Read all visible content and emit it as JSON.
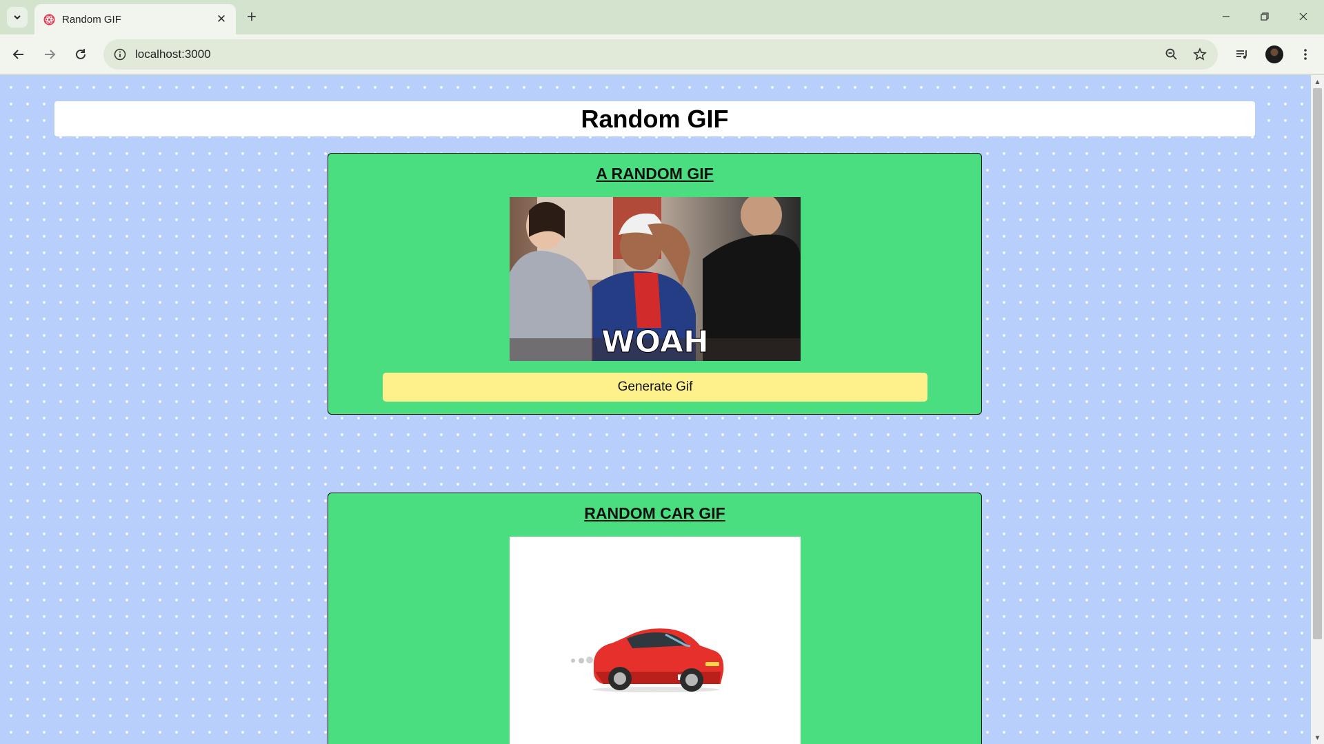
{
  "browser": {
    "tab_title": "Random GIF",
    "url": "localhost:3000"
  },
  "page": {
    "title": "Random GIF",
    "cards": [
      {
        "heading": "A RANDOM GIF",
        "gif_caption": "WOAH",
        "button_label": "Generate Gif"
      },
      {
        "heading": "RANDOM CAR GIF"
      }
    ]
  },
  "colors": {
    "page_background": "#b7cffa",
    "card_background": "#4ade80",
    "button_background": "#fef08a"
  }
}
